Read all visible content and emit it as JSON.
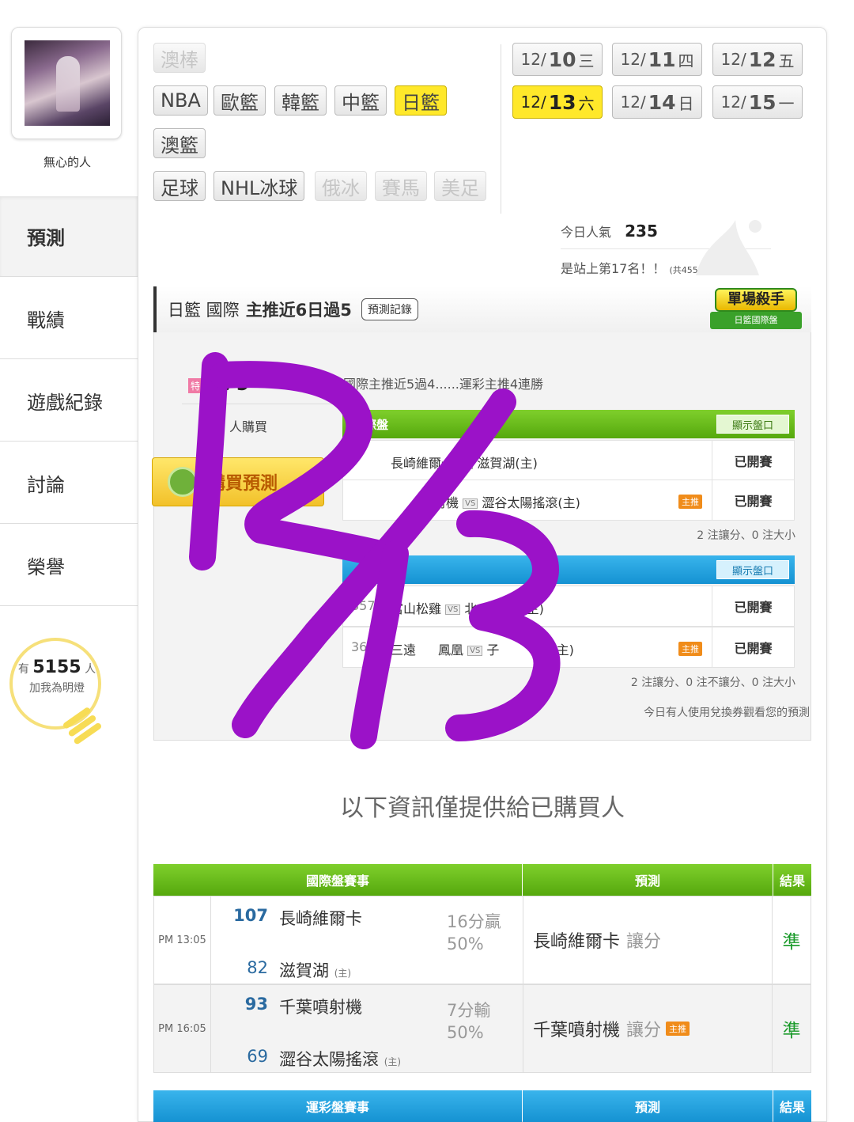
{
  "user": {
    "name": "無心的人"
  },
  "nav": [
    "預測",
    "戰績",
    "遊戲紀錄",
    "討論",
    "榮譽"
  ],
  "lamp": {
    "prefix": "有",
    "count": "5155",
    "unit": "人",
    "sub": "加我為明燈"
  },
  "sports": {
    "row1": [
      "澳棒"
    ],
    "row2": [
      "NBA",
      "歐籃",
      "韓籃",
      "中籃",
      "日籃"
    ],
    "row3": [
      "澳籃"
    ],
    "row4": [
      "足球",
      "NHL冰球",
      "俄冰",
      "賽馬",
      "美足"
    ]
  },
  "dates": [
    {
      "md": "12/",
      "d": "10",
      "w": "三"
    },
    {
      "md": "12/",
      "d": "11",
      "w": "四"
    },
    {
      "md": "12/",
      "d": "12",
      "w": "五"
    },
    {
      "md": "12/",
      "d": "13",
      "w": "六"
    },
    {
      "md": "12/",
      "d": "14",
      "w": "日"
    },
    {
      "md": "12/",
      "d": "15",
      "w": "一"
    }
  ],
  "popularity": {
    "label": "今日人氣",
    "value": "235",
    "rank": "是站上第17名！！",
    "total": "(共4555人)"
  },
  "prediction": {
    "league": "日籃 國際",
    "headline": "主推近6日過5",
    "record_btn": "預測記錄",
    "badge_main": "單場殺手",
    "badge_sub": "日籃國際盤",
    "tag": "特",
    "price_partial": "79",
    "buyers_partial": "人購買",
    "buy_btn": "購買預測",
    "note": "國際主推近5過4......運彩主推4連勝",
    "intl_title": "際盤",
    "lottery_title": "彩盤",
    "show_btn": "顯示盤口",
    "intl_rows": [
      {
        "game": "長崎維爾卡",
        "home": "滋賀湖(主)",
        "status": "已開賽"
      },
      {
        "game": "射機",
        "home": "澀谷太陽搖滾(主)",
        "master": "主推",
        "status": "已開賽"
      }
    ],
    "intl_summary": "2 注讓分、0 注大小",
    "lottery_rows": [
      {
        "no": "357",
        "game": "富山松雞",
        "home": "北",
        "home2": "神(主)",
        "status": "已開賽"
      },
      {
        "no": "36",
        "game": "三遠",
        "game2": "鳳凰",
        "home": "子",
        "home2": "者(主)",
        "master": "主推",
        "status": "已開賽"
      }
    ],
    "lottery_summary": "2 注讓分、0 注不讓分、0 注大小",
    "voucher_note": "今日有人使用兌換券觀看您的預測",
    "vs": "VS"
  },
  "info_line": "以下資訊僅提供給已購買人",
  "results": {
    "headers": {
      "intl": "國際盤賽事",
      "pred": "預測",
      "res": "結果",
      "lottery": "運彩盤賽事"
    },
    "rows": [
      {
        "time": "PM 13:05",
        "s1": "107",
        "t1": "長崎維爾卡",
        "s2": "82",
        "t2": "滋賀湖",
        "home": "(主)",
        "line1": "16分贏",
        "line2": "50%",
        "pick": "長崎維爾卡",
        "type": "讓分",
        "result": "準"
      },
      {
        "time": "PM 16:05",
        "s1": "93",
        "t1": "千葉噴射機",
        "s2": "69",
        "t2": "澀谷太陽搖滾",
        "home": "(主)",
        "line1": "7分輸",
        "line2": "50%",
        "pick": "千葉噴射機",
        "type": "讓分",
        "master": "主推",
        "result": "準"
      }
    ]
  },
  "colors": {
    "green": "#6cbf1a",
    "blue": "#1aa0de",
    "yellow": "#ffe82a",
    "scribble": "#9b12c8"
  }
}
